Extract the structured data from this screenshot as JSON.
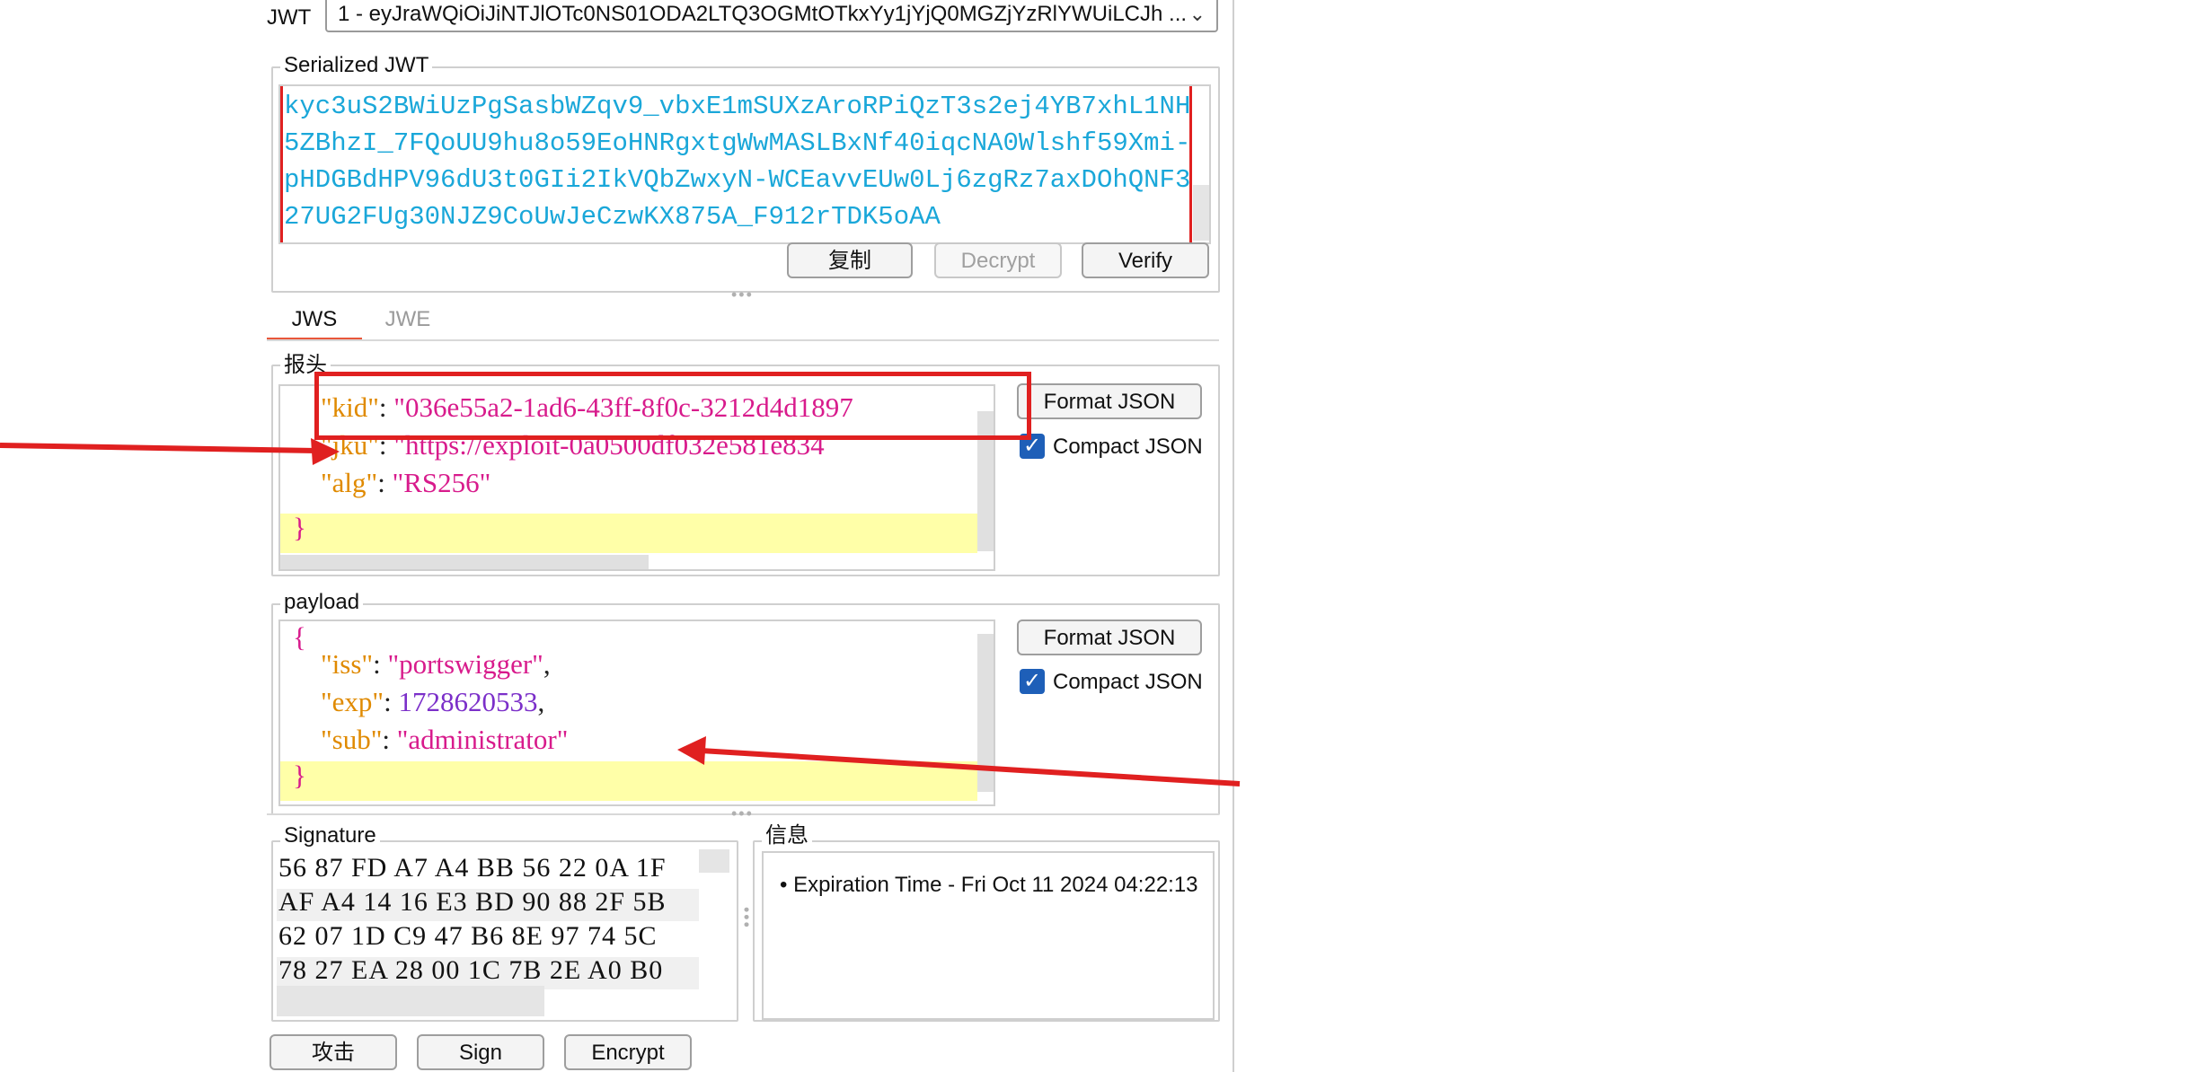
{
  "jwt_selector": {
    "label": "JWT",
    "value": "1 - eyJraWQiOiJiNTJlOTc0NS01ODA2LTQ3OGMtOTkxYy1jYjQ0MGZjYzRlYWUiLCJh ..."
  },
  "serialized_jwt": {
    "legend": "Serialized JWT",
    "text": "kyc3uS2BWiUzPgSasbWZqv9_vbxE1mSUXzAroRPiQzT3s2ej4YB7xhL1NH5ZBhzI_7FQoUU9hu8o59EoHNRgxtgWwMASLBxNf40iqcNA0Wlshf59Xmi-pHDGBdHPV96dU3t0GIi2IkVQbZwxyN-WCEavvEUw0Lj6zgRz7axDOhQNF327UG2FUg30NJZ9CoUwJeCzwKX875A_F912rTDK5oAA",
    "copy_button": "复制",
    "decrypt_button": "Decrypt",
    "verify_button": "Verify"
  },
  "tabs": [
    {
      "label": "JWS",
      "active": true
    },
    {
      "label": "JWE",
      "active": false
    }
  ],
  "header_section": {
    "legend": "报头",
    "lines": [
      {
        "key": "\"kid\"",
        "value": "\"036e55a2-1ad6-43ff-8f0c-3212d4d1897"
      },
      {
        "key": "\"jku\"",
        "value": "\"https://exploit-0a0500df032e581e834"
      },
      {
        "key": "\"alg\"",
        "value": "\"RS256\""
      }
    ],
    "close_brace": "}",
    "format_button": "Format JSON",
    "compact_label": "Compact JSON"
  },
  "payload_section": {
    "legend": "payload",
    "open_brace": "{",
    "lines": [
      {
        "key": "\"iss\"",
        "value": "\"portswigger\"",
        "type": "string",
        "trail": ","
      },
      {
        "key": "\"exp\"",
        "value": "1728620533",
        "type": "number",
        "trail": ","
      },
      {
        "key": "\"sub\"",
        "value": "\"administrator\"",
        "type": "string",
        "trail": ""
      }
    ],
    "close_brace": "}",
    "format_button": "Format JSON",
    "compact_label": "Compact JSON"
  },
  "signature": {
    "legend": "Signature",
    "rows": [
      "56 87 FD A7 A4 BB 56 22 0A 1F",
      "AF A4 14 16 E3 BD 90 88 2F 5B",
      "62 07 1D C9 47 B6 8E 97 74 5C",
      "78 27 EA 28 00 1C 7B 2E A0 B0"
    ]
  },
  "info": {
    "legend": "信息",
    "items": [
      "Expiration Time - Fri Oct 11 2024 04:22:13"
    ]
  },
  "bottom_buttons": {
    "attack": "攻击",
    "sign": "Sign",
    "encrypt": "Encrypt"
  },
  "colors": {
    "annotation_red": "#e02020",
    "json_key": "#e08a00",
    "json_string": "#d81b8c",
    "json_number": "#7b2fc9",
    "serialized_text": "#1aa7d9",
    "tab_accent": "#e8573a"
  }
}
